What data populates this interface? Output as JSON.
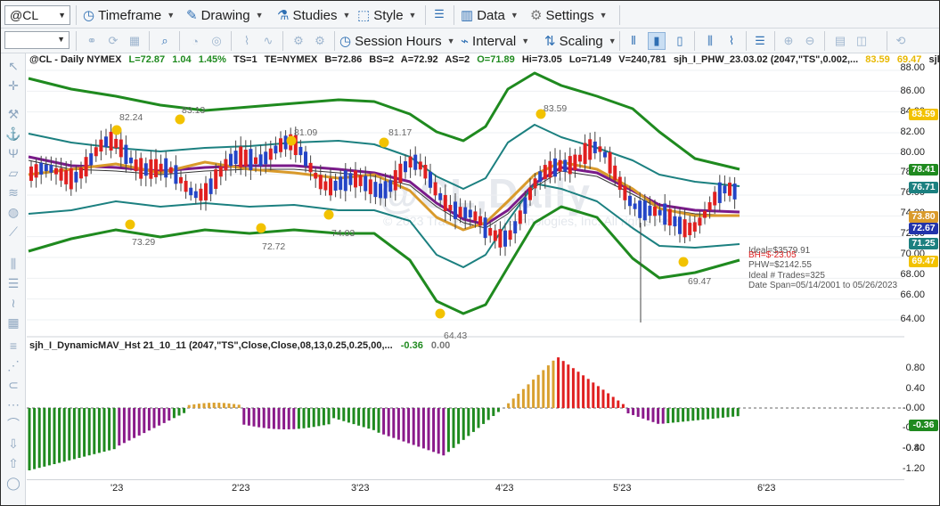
{
  "toolbar": {
    "symbol": "@CL",
    "items": [
      {
        "label": "Timeframe"
      },
      {
        "label": "Drawing"
      },
      {
        "label": "Studies"
      },
      {
        "label": "Style"
      },
      {
        "label": "Data"
      },
      {
        "label": "Settings"
      }
    ]
  },
  "toolbar2": {
    "session_label": "Session Hours",
    "interval_label": "Interval",
    "scaling_label": "Scaling"
  },
  "header": {
    "symbol": "@CL - Daily  NYMEX",
    "last": "L=72.87",
    "change": "1.04",
    "change_pct": "1.45%",
    "ts": "TS=1",
    "te": "TE=NYMEX",
    "bid": "B=72.86",
    "bs": "BS=2",
    "ask": "A=72.92",
    "as": "AS=2",
    "open": "O=71.89",
    "high": "Hi=73.05",
    "low": "Lo=71.49",
    "volume": "V=240,781",
    "study": "sjh_I_PHW_23.03.02 (2047,\"TS\",0.002,...",
    "study_v1": "83.59",
    "study_v2": "69.47",
    "study_tail": "sjh"
  },
  "price_axis": [
    "88.00",
    "86.00",
    "84.00",
    "82.00",
    "80.00",
    "78.00",
    "76.00",
    "74.00",
    "72.00",
    "70.00",
    "68.00",
    "66.00",
    "64.00"
  ],
  "price_tags": [
    {
      "value": "83.59",
      "color": "#f2c200"
    },
    {
      "value": "78.41",
      "color": "#1f8a1f"
    },
    {
      "value": "76.71",
      "color": "#1c8080"
    },
    {
      "value": "73.80",
      "color": "#d99a2b"
    },
    {
      "value": "72.67",
      "color": "#2233aa"
    },
    {
      "value": "71.25",
      "color": "#1c8080"
    },
    {
      "value": "69.47",
      "color": "#f2c200"
    }
  ],
  "point_labels": [
    "82.24",
    "83.13",
    "81.09",
    "81.17",
    "83.59",
    "73.29",
    "72.72",
    "74.03",
    "64.43",
    "69.47"
  ],
  "stats": {
    "ideal": "Ideal=$3579.91",
    "bh": "BH=$-23.05",
    "phw": "PHW=$2142.55",
    "trades": "Ideal # Trades=325",
    "span": "Date Span=05/14/2001 to 05/26/2023"
  },
  "watermark": "@CL,Daily",
  "watermark_sub": "© 2023 TradeStation Technologies, Inc. All rights reserved.",
  "indicator": {
    "title": "sjh_I_DynamicMAV_Hst 21_10_11 (2047,\"TS\",Close,Close,08,13,0.25,0.25,00,...",
    "v1": "-0.36",
    "v2": "0.00",
    "axis": [
      "0.80",
      "0.40",
      "-0.00",
      "-0.40",
      "-0.80",
      "-1.20"
    ],
    "tag": "-0.36"
  },
  "date_axis": [
    "'23",
    "2'23",
    "3'23",
    "4'23",
    "5'23",
    "6'23"
  ],
  "colors": {
    "up": "#2445c6",
    "down": "#e02020",
    "outer_band": "#1f8a1f",
    "inner_band": "#1c8080",
    "ma_purple": "#7a1a8a",
    "ma_orange": "#d99a2b",
    "hist_green": "#1f8a1f",
    "hist_purple": "#8a1a8a",
    "hist_gold": "#d9a030",
    "hist_red": "#e02020",
    "pivot": "#f2c200"
  }
}
